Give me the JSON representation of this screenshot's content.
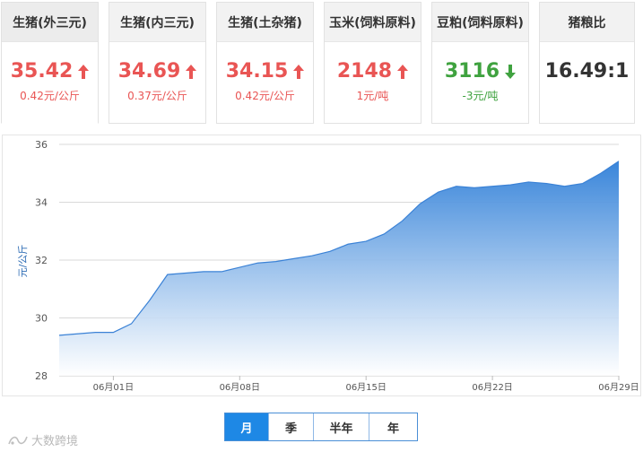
{
  "cards": [
    {
      "label": "生猪(外三元)",
      "price": "35.42",
      "change": "0.42元/公斤",
      "trend": "up",
      "active": true
    },
    {
      "label": "生猪(内三元)",
      "price": "34.69",
      "change": "0.37元/公斤",
      "trend": "up"
    },
    {
      "label": "生猪(土杂猪)",
      "price": "34.15",
      "change": "0.42元/公斤",
      "trend": "up"
    },
    {
      "label": "玉米(饲料原料)",
      "price": "2148",
      "change": "1元/吨",
      "trend": "up"
    },
    {
      "label": "豆粕(饲料原料)",
      "price": "3116",
      "change": "-3元/吨",
      "trend": "down"
    },
    {
      "label": "猪粮比",
      "price": "16.49:1",
      "change": "",
      "trend": "neutral"
    }
  ],
  "colors": {
    "up": "#e95554",
    "down": "#3fa23f",
    "area_top": "#2f7fd8",
    "line": "#3b82d6"
  },
  "chart_data": {
    "type": "area",
    "ylabel": "元/公斤",
    "ylim": [
      28,
      36
    ],
    "yticks": [
      "28",
      "30",
      "32",
      "34",
      "36"
    ],
    "xlabels": [
      "06月01日",
      "06月08日",
      "06月15日",
      "06月22日",
      "06月29日"
    ],
    "grid": true,
    "series": [
      {
        "x": [
          "05-29",
          "05-30",
          "05-31",
          "06-01",
          "06-02",
          "06-03",
          "06-04",
          "06-05",
          "06-06",
          "06-07",
          "06-08",
          "06-09",
          "06-10",
          "06-11",
          "06-12",
          "06-13",
          "06-14",
          "06-15",
          "06-16",
          "06-17",
          "06-18",
          "06-19",
          "06-20",
          "06-21",
          "06-22",
          "06-23",
          "06-24",
          "06-25",
          "06-26",
          "06-27",
          "06-28",
          "06-29"
        ],
        "values": [
          29.4,
          29.45,
          29.5,
          29.5,
          29.8,
          30.6,
          31.5,
          31.55,
          31.6,
          31.6,
          31.75,
          31.9,
          31.95,
          32.05,
          32.15,
          32.3,
          32.55,
          32.65,
          32.9,
          33.35,
          33.95,
          34.35,
          34.55,
          34.5,
          34.55,
          34.6,
          34.7,
          34.65,
          34.55,
          34.65,
          35.0,
          35.42
        ]
      }
    ]
  },
  "ranges": [
    "月",
    "季",
    "半年",
    "年"
  ],
  "selected_range": "月",
  "watermark": "大数跨境"
}
